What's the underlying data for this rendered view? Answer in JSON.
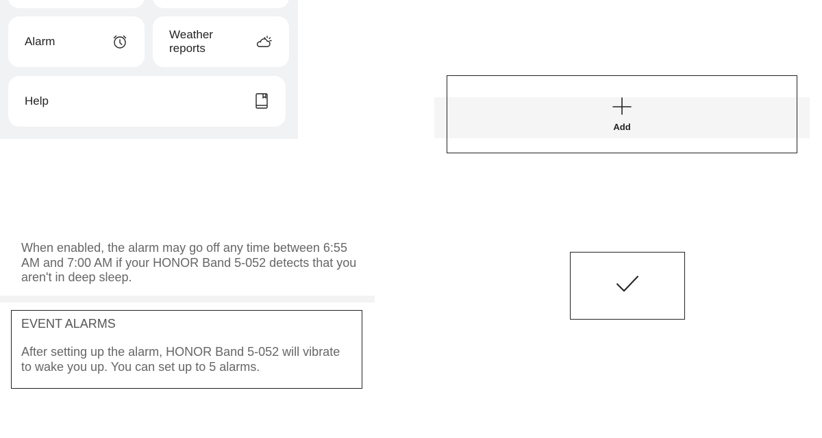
{
  "settings": {
    "alarm_label": "Alarm",
    "weather_label_line1": "Weather",
    "weather_label_line2": "reports",
    "help_label": "Help",
    "alarm_icon": "alarm-clock-icon",
    "weather_icon": "partly-cloudy-icon",
    "help_icon": "book-icon"
  },
  "add": {
    "label": "Add",
    "icon": "plus-icon"
  },
  "smart_alarm": {
    "description": "When enabled, the alarm may go off any time between 6:55 AM and 7:00 AM if your HONOR Band 5-052 detects that you aren't in deep sleep."
  },
  "event_alarms": {
    "title": "EVENT ALARMS",
    "description": "After setting up the alarm, HONOR Band 5-052 will vibrate to wake you up. You can set up to 5 alarms."
  },
  "confirm": {
    "icon": "checkmark-icon"
  }
}
